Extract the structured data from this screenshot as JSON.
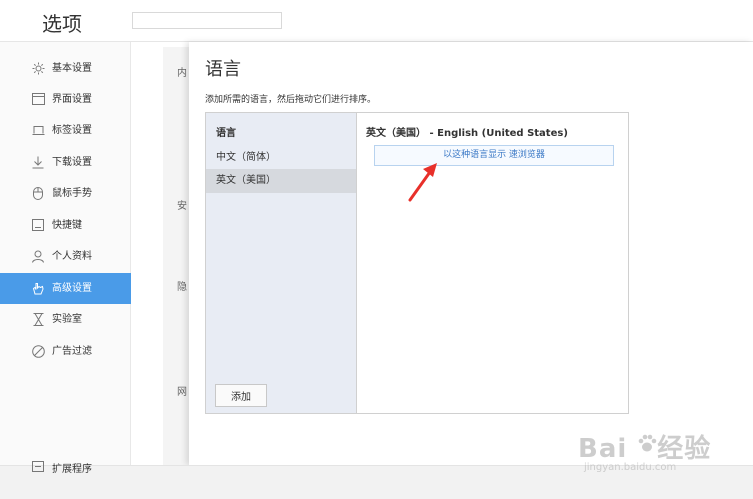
{
  "header": {
    "title": "选项",
    "search_placeholder": ""
  },
  "sidebar": {
    "items": [
      {
        "label": "基本设置",
        "icon": "gear-icon"
      },
      {
        "label": "界面设置",
        "icon": "window-icon"
      },
      {
        "label": "标签设置",
        "icon": "tab-icon"
      },
      {
        "label": "下载设置",
        "icon": "download-icon"
      },
      {
        "label": "鼠标手势",
        "icon": "mouse-icon"
      },
      {
        "label": "快捷键",
        "icon": "keyboard-icon"
      },
      {
        "label": "个人资料",
        "icon": "person-icon"
      },
      {
        "label": "高级设置",
        "icon": "hand-icon",
        "active": true
      },
      {
        "label": "实验室",
        "icon": "hourglass-icon"
      },
      {
        "label": "广告过滤",
        "icon": "block-icon"
      }
    ],
    "extensions": {
      "label": "扩展程序",
      "icon": "puzzle-icon"
    }
  },
  "background_fragments": [
    "内",
    "安",
    "隐",
    "网"
  ],
  "dialog": {
    "title": "语言",
    "description": "添加所需的语言，然后拖动它们进行排序。",
    "list_header": "语言",
    "languages": [
      {
        "label": "中文（简体）"
      },
      {
        "label": "英文（美国）",
        "selected": true
      }
    ],
    "add_label": "添加",
    "detail_title": "英文（美国） - English (United States)",
    "display_button_label": "以这种语言显示        速浏览器"
  },
  "watermark": {
    "brand": "Bai",
    "brand_suffix": "经验",
    "url": "jingyan.baidu.com"
  },
  "colors": {
    "accent": "#4a9be8",
    "arrow": "#e8302a"
  }
}
